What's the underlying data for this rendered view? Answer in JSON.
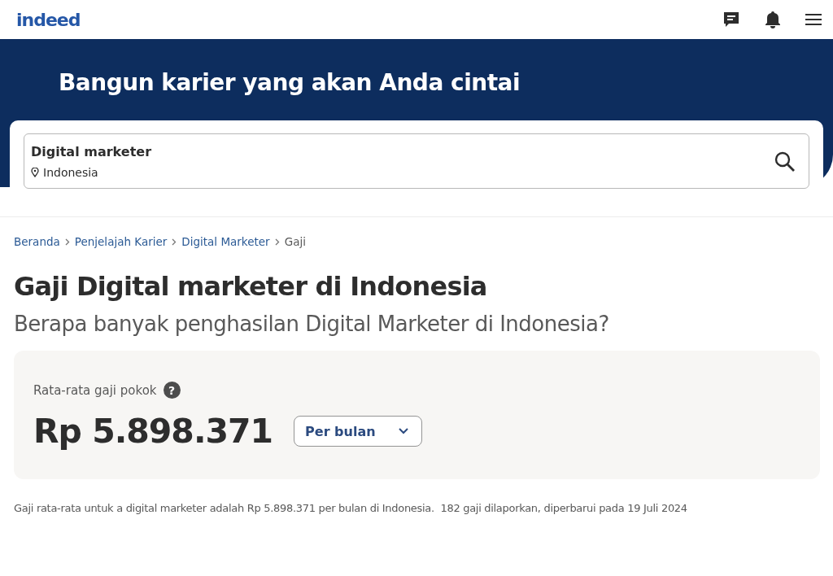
{
  "header": {
    "logo": "indeed"
  },
  "hero": {
    "title": "Bangun karier yang akan Anda cintai",
    "what": "Digital marketer",
    "where": "Indonesia"
  },
  "breadcrumbs": [
    {
      "label": "Beranda",
      "link": true
    },
    {
      "label": "Penjelajah Karier",
      "link": true
    },
    {
      "label": "Digital Marketer",
      "link": true
    },
    {
      "label": "Gaji",
      "link": false
    }
  ],
  "page": {
    "title": "Gaji Digital marketer di Indonesia",
    "subtitle": "Berapa banyak penghasilan Digital Marketer di Indonesia?"
  },
  "salary": {
    "label": "Rata-rata gaji pokok",
    "help": "?",
    "amount": "Rp 5.898.371",
    "period": "Per bulan"
  },
  "footnote": "Gaji rata-rata untuk a digital marketer adalah Rp 5.898.371 per bulan di Indonesia.  182 gaji dilaporkan, diperbarui pada 19 Juli 2024"
}
